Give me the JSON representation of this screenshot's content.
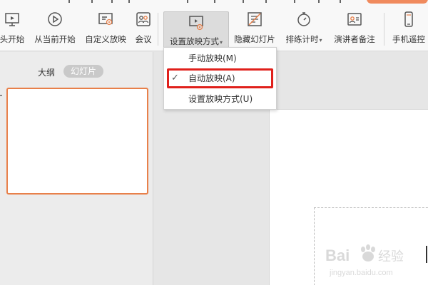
{
  "toolbar": {
    "items": [
      {
        "label": "头开始",
        "icon": "monitor-play-icon"
      },
      {
        "label": "从当前开始",
        "icon": "play-circle-icon"
      },
      {
        "label": "自定义放映",
        "icon": "custom-slideshow-icon"
      },
      {
        "label": "会议",
        "icon": "meeting-icon"
      },
      {
        "label": "设置放映方式",
        "icon": "slideshow-settings-icon",
        "has_dropdown": true
      },
      {
        "label": "隐藏幻灯片",
        "icon": "hide-slide-icon"
      },
      {
        "label": "排练计时",
        "icon": "stopwatch-icon",
        "has_dropdown": true
      },
      {
        "label": "演讲者备注",
        "icon": "speaker-notes-icon"
      },
      {
        "label": "手机遥控",
        "icon": "phone-remote-icon"
      }
    ],
    "caret": "▾"
  },
  "dropdown": {
    "items": [
      {
        "label": "手动放映(M)",
        "checked": false
      },
      {
        "label": "自动放映(A)",
        "checked": true
      },
      {
        "label": "设置放映方式(U)",
        "checked": false
      }
    ],
    "check_glyph": "✓"
  },
  "left_pane": {
    "tab_outline": "大纲",
    "tab_slides": "幻灯片"
  },
  "colors": {
    "accent": "#e8804a",
    "highlight_box": "#e0201b",
    "top_pill": "#f08a5d"
  },
  "watermark": {
    "brand": "Bai 经验",
    "url": "jingyan.baidu.com"
  }
}
